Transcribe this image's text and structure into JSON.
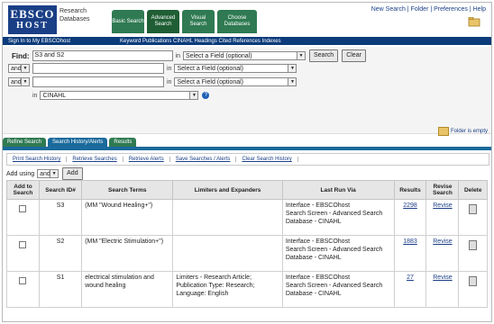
{
  "brand": {
    "logo_line1": "EBSCO",
    "logo_line2": "HOST",
    "db_line1": "Research",
    "db_line2": "Databases"
  },
  "top_tabs": [
    {
      "label": "Basic Search"
    },
    {
      "label": "Advanced Search"
    },
    {
      "label": "Visual Search"
    },
    {
      "label": "Choose Databases"
    }
  ],
  "top_links": {
    "new_search": "New Search",
    "sep1": " | ",
    "folder": "Folder",
    "sep2": " | ",
    "preferences": "Preferences",
    "sep3": " | ",
    "help": "Help"
  },
  "nav_bar": {
    "item1": "Sign In to My EBSCOhost",
    "item2": "Keyword  Publications  CINAHL Headings  Cited References  Indexes"
  },
  "search": {
    "find_label": "Find:",
    "row1_value": "S3 and S2",
    "row2_bool": "and",
    "row3_bool": "and",
    "in_label": "in",
    "field_placeholder": "Select a Field (optional)",
    "db_in_label": "in",
    "db_value": "CINAHL",
    "search_btn": "Search",
    "clear_btn": "Clear"
  },
  "folder_status": "Folder is empty",
  "sub_tabs": [
    {
      "label": "Refine Search"
    },
    {
      "label": "Search History/Alerts"
    },
    {
      "label": "Results"
    }
  ],
  "history_links": [
    "Print Search History",
    "Retrieve Searches",
    "Retrieve Alerts",
    "Save Searches / Alerts",
    "Clear Search History"
  ],
  "add_using": {
    "label": "Add using",
    "value": "and",
    "btn": "Add"
  },
  "table": {
    "headers": [
      "Add to Search",
      "Search ID#",
      "Search Terms",
      "Limiters and Expanders",
      "Last Run Via",
      "Results",
      "Revise Search",
      "Delete"
    ],
    "rows": [
      {
        "id": "S3",
        "terms": "(MM \"Wound Healing+\")",
        "limiters": "",
        "run_iface": "Interface - EBSCOhost",
        "run_screen": "Search Screen - Advanced Search",
        "run_db": "Database - CINAHL",
        "results": "2298",
        "revise": "Revise"
      },
      {
        "id": "S2",
        "terms": "(MM \"Electric Stimulation+\")",
        "limiters": "",
        "run_iface": "Interface - EBSCOhost",
        "run_screen": "Search Screen - Advanced Search",
        "run_db": "Database - CINAHL",
        "results": "1883",
        "revise": "Revise"
      },
      {
        "id": "S1",
        "terms": "electrical stimulation and wound healing",
        "limiters": "Limiters - Research Article; Publication Type: Research; Language: English",
        "run_iface": "Interface - EBSCOhost",
        "run_screen": "Search Screen - Advanced Search",
        "run_db": "Database - CINAHL",
        "results": "27",
        "revise": "Revise"
      }
    ]
  }
}
